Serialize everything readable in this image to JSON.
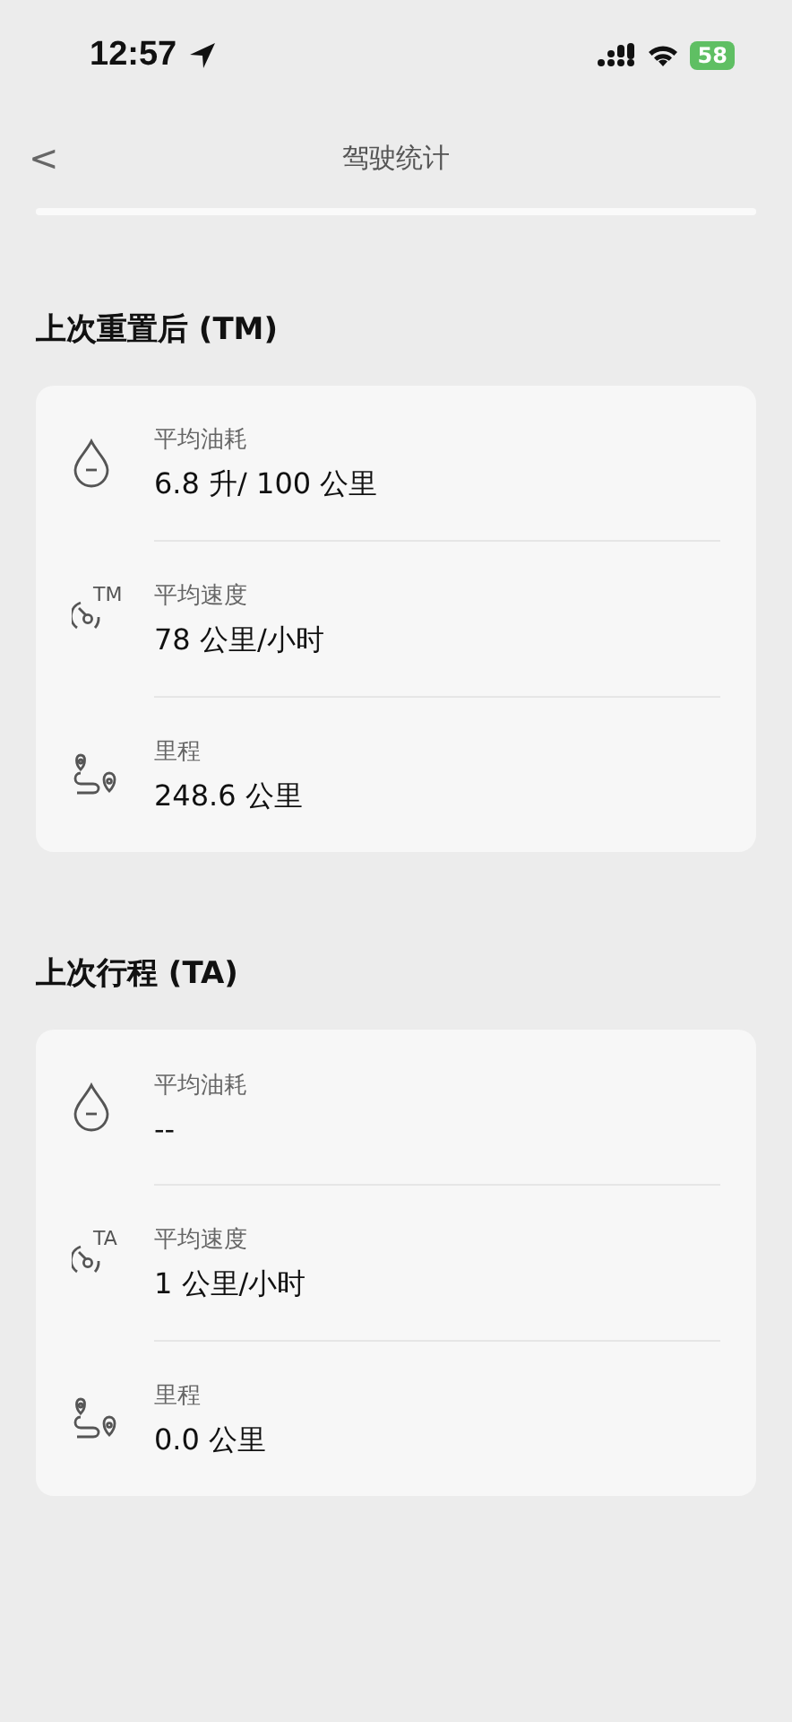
{
  "status_bar": {
    "time": "12:57",
    "battery": "58"
  },
  "nav": {
    "back": "<",
    "title": "驾驶统计"
  },
  "sections": [
    {
      "title": "上次重置后 (TM)",
      "rows": [
        {
          "kind": "fuel",
          "label": "平均油耗",
          "value": "6.8 升/ 100 公里"
        },
        {
          "kind": "speed",
          "badge": "TM",
          "label": "平均速度",
          "value": "78 公里/小时"
        },
        {
          "kind": "distance",
          "label": "里程",
          "value": "248.6 公里"
        }
      ]
    },
    {
      "title": "上次行程 (TA)",
      "rows": [
        {
          "kind": "fuel",
          "label": "平均油耗",
          "value": "--"
        },
        {
          "kind": "speed",
          "badge": "TA",
          "label": "平均速度",
          "value": "1 公里/小时"
        },
        {
          "kind": "distance",
          "label": "里程",
          "value": "0.0 公里"
        }
      ]
    }
  ]
}
